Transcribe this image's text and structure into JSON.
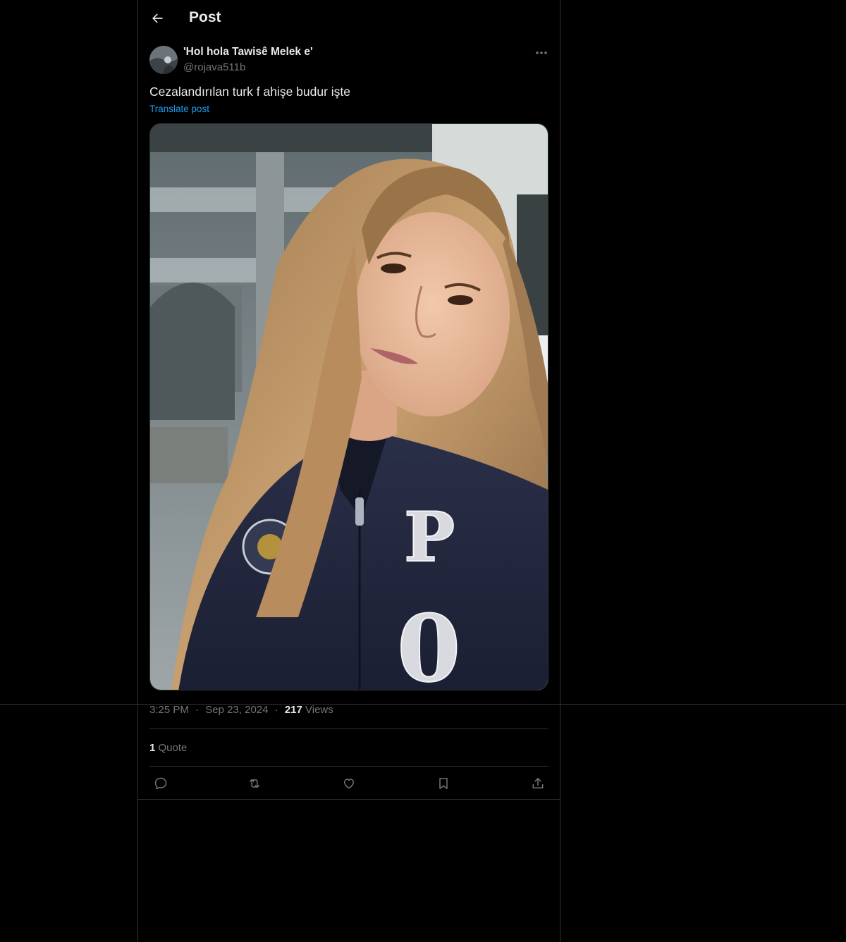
{
  "topbar": {
    "title": "Post",
    "back_icon": "arrow-left-icon"
  },
  "post": {
    "author": {
      "display_name": "'Hol hola Tawisê Melek e'",
      "handle": "@rojava511b"
    },
    "text": "Cezalandırılan turk f ahişe budur işte",
    "translate_label": "Translate post",
    "media": {
      "description_icon": "photo"
    },
    "meta": {
      "time": "3:25 PM",
      "separator": "·",
      "date": "Sep 23, 2024",
      "views_count": "217",
      "views_label": "Views"
    },
    "stats": {
      "quote_count": "1",
      "quote_label": "Quote"
    },
    "actions": [
      "reply-icon",
      "repost-icon",
      "like-icon",
      "bookmark-icon",
      "share-icon"
    ]
  },
  "colors": {
    "background": "#000000",
    "text": "#e7e9ea",
    "muted": "#71767b",
    "accent": "#1d9bf0",
    "border": "#2f3336"
  }
}
